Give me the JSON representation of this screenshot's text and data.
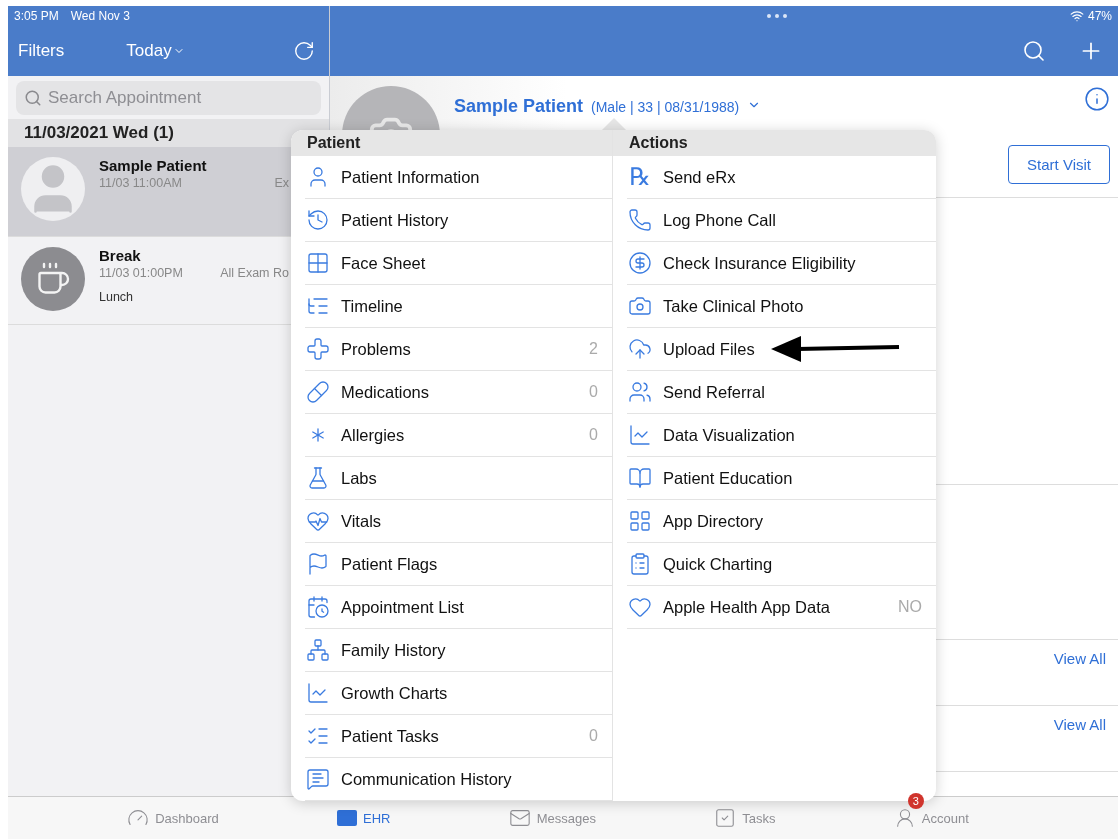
{
  "status_bar": {
    "time": "3:05 PM",
    "date": "Wed Nov 3",
    "battery": "47%"
  },
  "left_nav": {
    "filters": "Filters",
    "date_filter": "Today"
  },
  "search": {
    "placeholder": "Search Appointment"
  },
  "appointments_header": "11/03/2021 Wed (1)",
  "appointments": [
    {
      "kind": "patient",
      "name": "Sample Patient",
      "time": "11/03 11:00AM",
      "column_3": "Ex",
      "selected": true
    },
    {
      "kind": "break",
      "name": "Break",
      "time": "11/03 01:00PM",
      "column_3": "All Exam Ro",
      "note": "Lunch",
      "selected": false
    }
  ],
  "patient": {
    "name": "Sample Patient",
    "details": "(Male | 33 | 08/31/1988)",
    "start_button": "Start Visit",
    "links": [
      "View All",
      "View All"
    ]
  },
  "menu": {
    "columns": [
      {
        "title": "Patient",
        "items": [
          {
            "label": "Patient Information"
          },
          {
            "label": "Patient History"
          },
          {
            "label": "Face Sheet"
          },
          {
            "label": "Timeline"
          },
          {
            "label": "Problems",
            "count": "2"
          },
          {
            "label": "Medications",
            "count": "0"
          },
          {
            "label": "Allergies",
            "count": "0"
          },
          {
            "label": "Labs"
          },
          {
            "label": "Vitals"
          },
          {
            "label": "Patient Flags"
          },
          {
            "label": "Appointment List"
          },
          {
            "label": "Family History"
          },
          {
            "label": "Growth Charts"
          },
          {
            "label": "Patient Tasks",
            "count": "0"
          },
          {
            "label": "Communication History"
          }
        ]
      },
      {
        "title": "Actions",
        "items": [
          {
            "label": "Send eRx",
            "glyph": "℞",
            "annotated": false
          },
          {
            "label": "Log Phone Call",
            "annotated": false
          },
          {
            "label": "Check Insurance Eligibility",
            "annotated": false
          },
          {
            "label": "Take Clinical Photo",
            "annotated": false
          },
          {
            "label": "Upload Files",
            "annotated": true
          },
          {
            "label": "Send Referral",
            "annotated": false
          },
          {
            "label": "Data Visualization",
            "annotated": false
          },
          {
            "label": "Patient Education",
            "annotated": false
          },
          {
            "label": "App Directory",
            "annotated": false
          },
          {
            "label": "Quick Charting",
            "annotated": false
          },
          {
            "label": "Apple Health App Data",
            "count": "NO",
            "annotated": false
          }
        ]
      }
    ]
  },
  "tab_bar": [
    {
      "label": "Dashboard",
      "selected": false
    },
    {
      "label": "EHR",
      "selected": true
    },
    {
      "label": "Messages",
      "selected": false
    },
    {
      "label": "Tasks",
      "selected": false
    },
    {
      "label": "Account",
      "selected": false,
      "badge": "3"
    }
  ]
}
